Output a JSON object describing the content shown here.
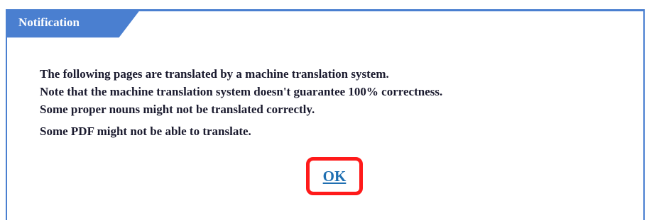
{
  "dialog": {
    "title": "Notification",
    "lines": [
      "The following pages are translated by a machine translation system.",
      "Note that the machine translation system doesn't guarantee 100% correctness.",
      "Some proper nouns might not be translated correctly.",
      "Some PDF might not be able to translate."
    ],
    "ok_label": "OK"
  },
  "colors": {
    "accent": "#4a7fd0",
    "highlight": "#ff1a1a",
    "link": "#1f6fb2"
  }
}
